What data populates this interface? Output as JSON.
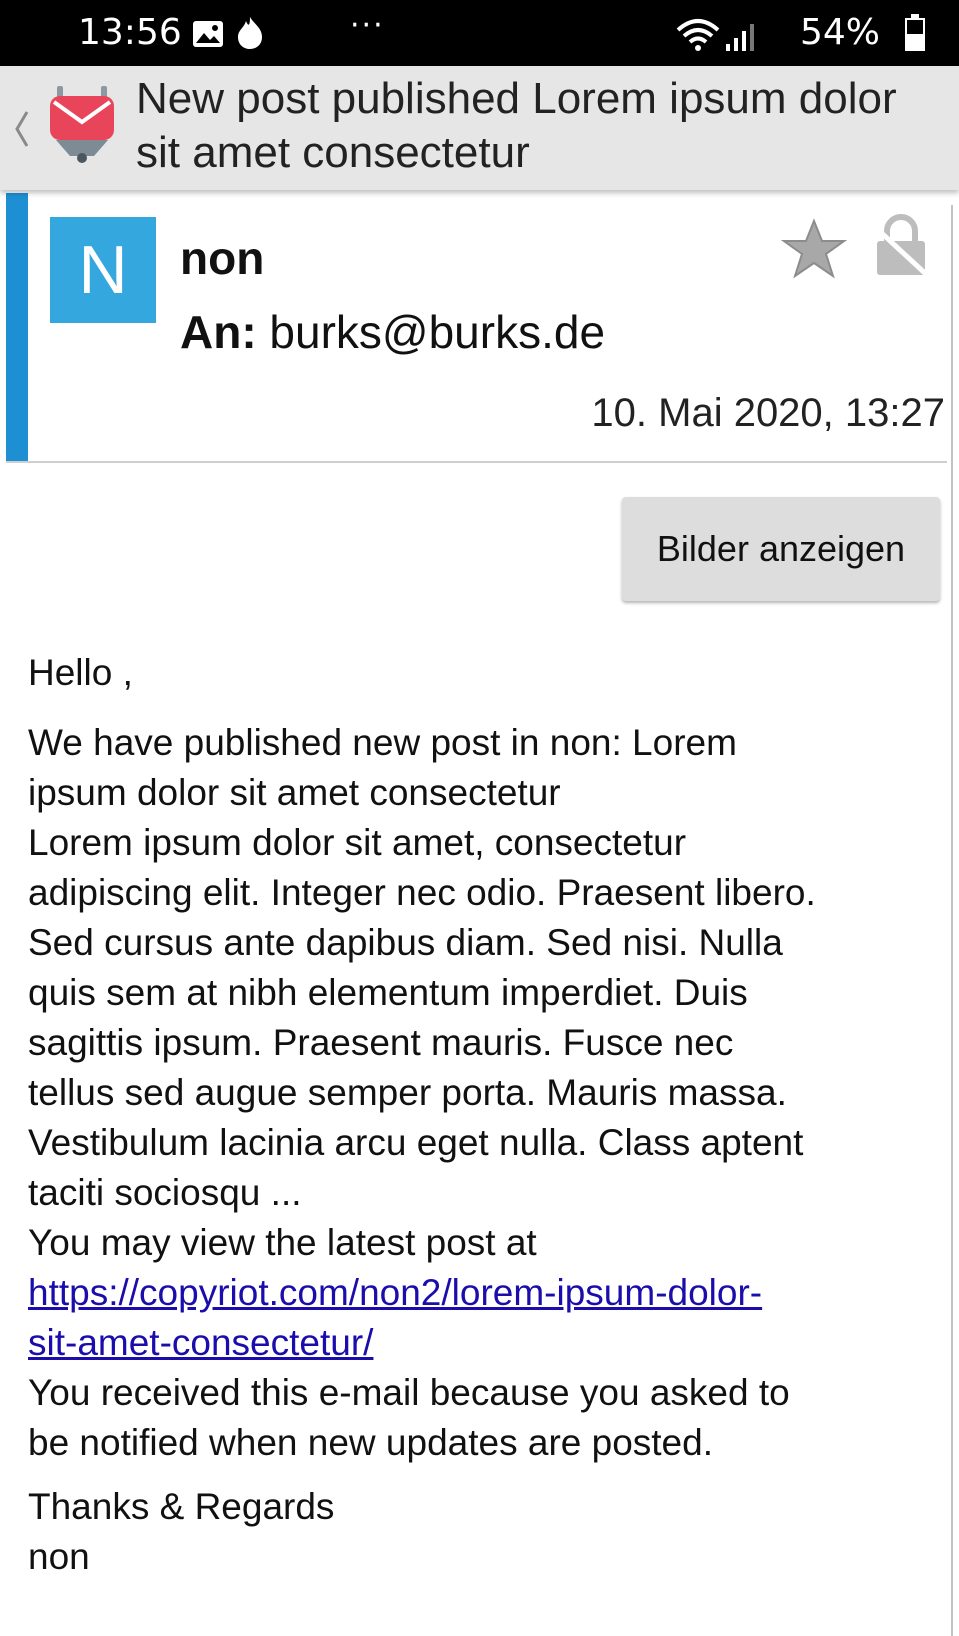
{
  "status_bar": {
    "time": "13:56",
    "overflow": "···",
    "battery_percent": "54%",
    "icons": [
      "image-icon",
      "flame-icon",
      "wifi-icon",
      "signal-icon",
      "battery-icon"
    ]
  },
  "app_bar": {
    "title": "New post published Lorem ipsum dolor sit amet consectetur",
    "icons": [
      "back-chevron-icon",
      "app-logo-icon"
    ]
  },
  "message_header": {
    "avatar_letter": "N",
    "sender": "non",
    "to_label": "An:",
    "recipient": "burks@burks.de",
    "date": "10. Mai 2020, 13:27",
    "icons": [
      "star-icon",
      "lock-icon"
    ]
  },
  "actions": {
    "show_images": "Bilder anzeigen"
  },
  "body": {
    "greeting": "Hello ,",
    "intro_lines": [
      "We have published new post in non: Lorem",
      "ipsum dolor sit amet consectetur"
    ],
    "excerpt_lines": [
      "Lorem ipsum dolor sit amet, consectetur",
      "adipiscing elit. Integer nec odio. Praesent libero.",
      "Sed cursus ante dapibus diam. Sed nisi. Nulla",
      "quis sem at nibh elementum imperdiet. Duis",
      "sagittis ipsum. Praesent mauris. Fusce nec",
      "tellus sed augue semper porta. Mauris massa.",
      "Vestibulum lacinia arcu eget nulla. Class aptent",
      "taciti sociosqu ..."
    ],
    "view_text": "You may view the latest post at",
    "link_lines": [
      "https://copyriot.com/non2/lorem-ipsum-dolor-",
      "sit-amet-consectetur/"
    ],
    "notice_lines": [
      "You received this e-mail because you asked to",
      "be notified when new updates are posted."
    ],
    "closing": "Thanks & Regards",
    "signature": "non"
  },
  "colors": {
    "accent_bar": "#1e8fd3",
    "avatar_bg": "#34a7de",
    "link": "#1a0dab",
    "logo_red": "#e9455a"
  }
}
